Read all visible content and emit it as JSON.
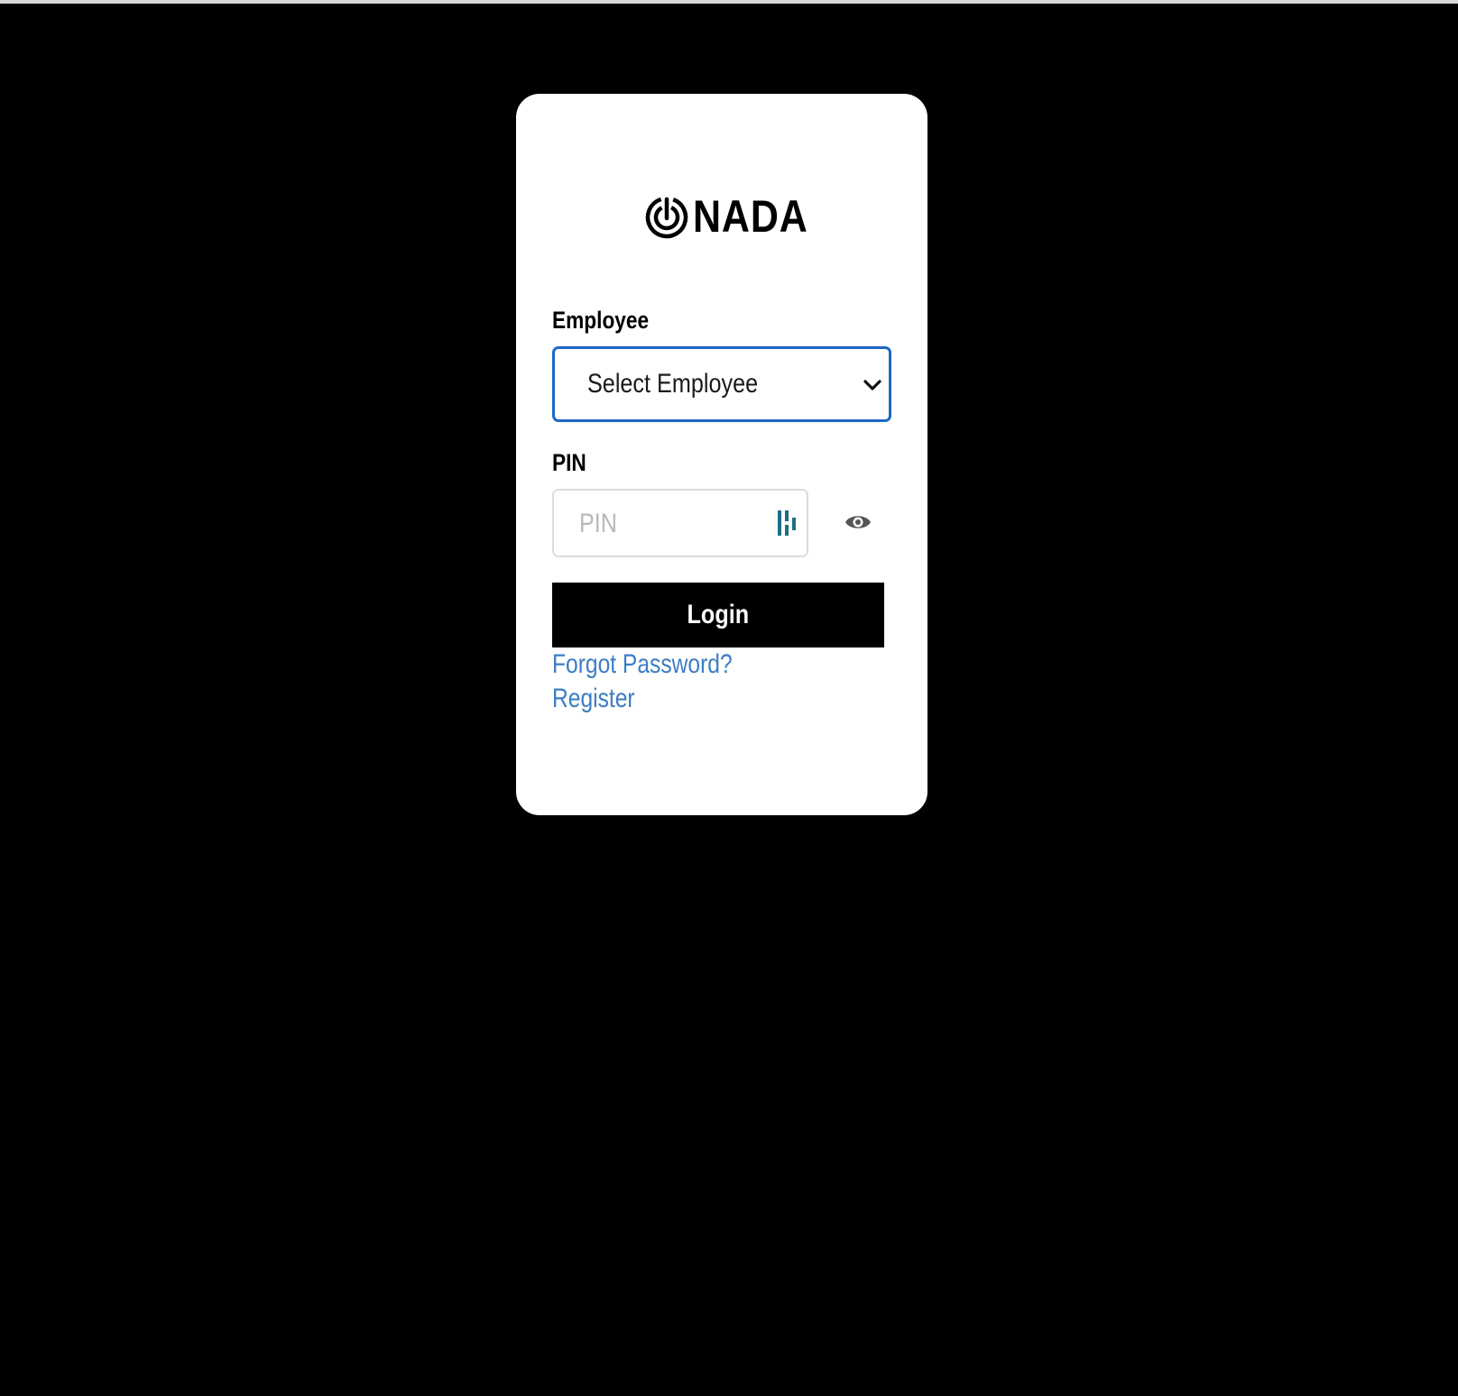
{
  "brand": {
    "name": "NADA",
    "logo_icon": "target-power-icon"
  },
  "form": {
    "employee_label": "Employee",
    "employee_select_value": "Select Employee",
    "pin_label": "PIN",
    "pin_placeholder": "PIN",
    "pin_value": "",
    "login_label": "Login"
  },
  "links": {
    "forgot_password": "Forgot Password?",
    "register": "Register"
  },
  "colors": {
    "background": "#000000",
    "card": "#ffffff",
    "select_border": "#1f66c9",
    "link": "#3b7dc4",
    "button": "#000000",
    "password_manager_icon": "#1e6f84"
  },
  "icons": {
    "dropdown": "chevron-down-icon",
    "password_manager": "password-manager-icon",
    "show_password": "eye-icon"
  }
}
